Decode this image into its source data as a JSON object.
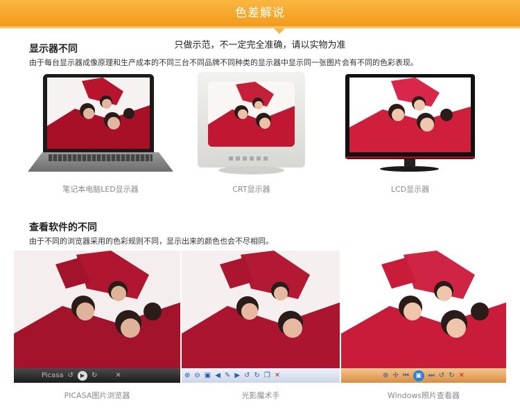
{
  "banner": {
    "title": "色差解说",
    "color": "#f5a62a"
  },
  "note": "只做示范，不一定完全准确，请以实物为准",
  "section1": {
    "heading": "显示器不同",
    "description": "由于每台显示器成像原理和生产成本的不同三台不同品牌不同种类的显示器中显示同一张图片会有不同的色彩表现。",
    "items": [
      {
        "caption": "笔记本电脑LED显示器",
        "kind": "laptop"
      },
      {
        "caption": "CRT显示器",
        "kind": "crt"
      },
      {
        "caption": "LCD显示器",
        "kind": "lcd"
      }
    ]
  },
  "section2": {
    "heading": "查看软件的不同",
    "description": "由于不同的浏览器采用的色彩规则不同，显示出来的颜色也会不尽相同。",
    "items": [
      {
        "caption": "PICASA图片浏览器",
        "toolbar_text": "Picasa",
        "toolbar_style": "dark"
      },
      {
        "caption": "光影魔术手",
        "toolbar_style": "light"
      },
      {
        "caption": "Windows照片查看器",
        "toolbar_style": "orange"
      }
    ]
  },
  "icons": [
    "zoom-icon",
    "rotate-icon",
    "play-icon",
    "delete-icon",
    "fit-icon",
    "prev-icon",
    "next-icon"
  ],
  "colors": {
    "accent": "#f5a62a",
    "shirt_red": "#b3122a",
    "muted_caption": "#888888"
  }
}
